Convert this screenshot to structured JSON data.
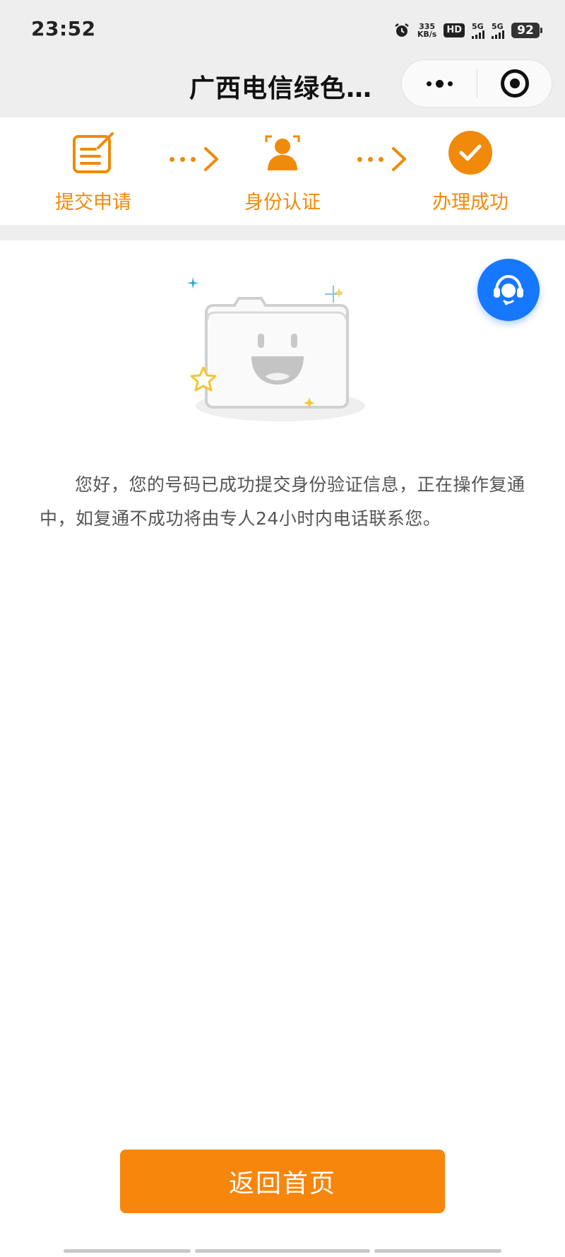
{
  "status_bar": {
    "time": "23:52",
    "net_speed_value": "335",
    "net_speed_unit": "KB/s",
    "hd_label": "HD",
    "sim1_label": "5G",
    "sim2_label": "5G",
    "battery": "92",
    "icons": [
      "alarm-icon",
      "hd-volte-icon",
      "signal-5g-icon",
      "signal-5g-icon",
      "battery-icon"
    ]
  },
  "nav": {
    "title": "广西电信绿色…",
    "more_icon": "more-dots-icon",
    "close_icon": "target-close-icon"
  },
  "steps": [
    {
      "label": "提交申请",
      "icon": "edit-form-icon"
    },
    {
      "label": "身份认证",
      "icon": "face-scan-icon"
    },
    {
      "label": "办理成功",
      "icon": "check-circle-icon"
    }
  ],
  "accent_color": "#f08a0a",
  "illustration": "empty-folder-smiley-illustration",
  "customer_service_icon": "headset-agent-icon",
  "message": "您好，您的号码已成功提交身份验证信息，正在操作复通中，如复通不成功将由专人24小时内电话联系您。",
  "home_button": "返回首页"
}
